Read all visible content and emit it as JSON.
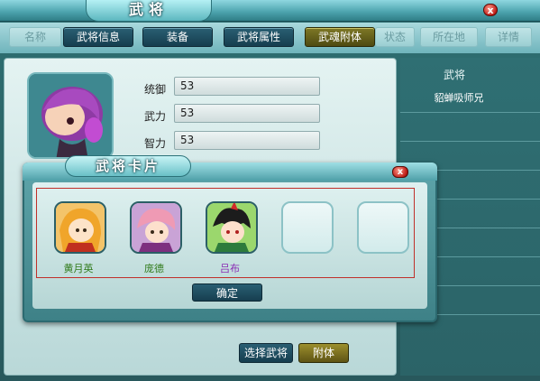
{
  "window": {
    "title": "武将",
    "close_label": "x"
  },
  "tabs": [
    {
      "label": "名称",
      "state": "dim"
    },
    {
      "label": "武将信息",
      "state": "on"
    },
    {
      "label": "装备",
      "state": "on"
    },
    {
      "label": "武将属性",
      "state": "on"
    },
    {
      "label": "武魂附体",
      "state": "gold"
    },
    {
      "label": "状态",
      "state": "dim"
    },
    {
      "label": "所在地",
      "state": "dim"
    },
    {
      "label": "详情",
      "state": "dim"
    }
  ],
  "hero": {
    "stats": [
      {
        "label": "统御",
        "value": "53"
      },
      {
        "label": "武力",
        "value": "53"
      },
      {
        "label": "智力",
        "value": "53"
      }
    ]
  },
  "right_list": {
    "header": "武将",
    "items": [
      "貂蝉吸师兄"
    ]
  },
  "actions": {
    "select_label": "选择武将",
    "attach_label": "附体"
  },
  "modal": {
    "title": "武将卡片",
    "close_label": "x",
    "confirm_label": "确定",
    "cards": [
      {
        "name": "黄月英",
        "color": "#2f7a19"
      },
      {
        "name": "庞德",
        "color": "#2f7a19"
      },
      {
        "name": "吕布",
        "color": "#8a2bb4"
      },
      {
        "name": "",
        "color": ""
      },
      {
        "name": "",
        "color": ""
      }
    ]
  }
}
